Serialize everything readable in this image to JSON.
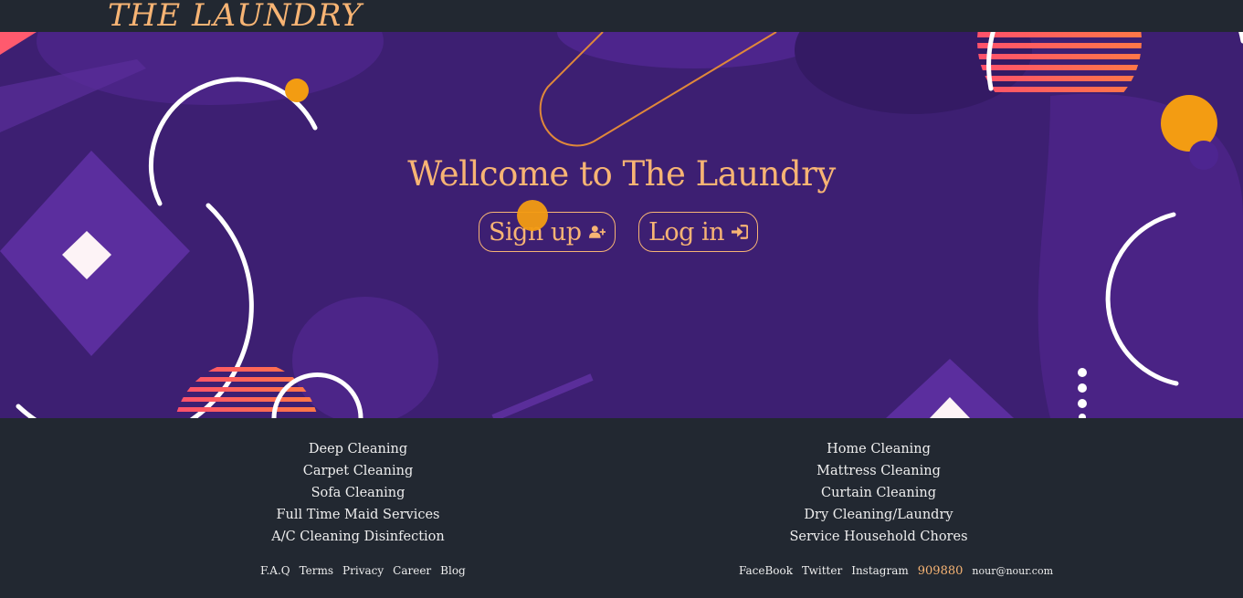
{
  "header": {
    "logo": "THE LAUNDRY"
  },
  "hero": {
    "title": "Wellcome to The Laundry",
    "signup_label": "Sign up",
    "login_label": "Log in"
  },
  "footer": {
    "services_left": [
      "Deep Cleaning",
      "Carpet Cleaning",
      "Sofa Cleaning",
      "Full Time Maid Services",
      "A/C Cleaning Disinfection"
    ],
    "services_right": [
      "Home Cleaning",
      "Mattress Cleaning",
      "Curtain Cleaning",
      "Dry Cleaning/Laundry",
      "Service Household Chores"
    ],
    "links_left": [
      "F.A.Q",
      "Terms",
      "Privacy",
      "Career",
      "Blog"
    ],
    "social": [
      "FaceBook",
      "Twitter",
      "Instagram"
    ],
    "phone": "909880",
    "email": "nour@nour.com"
  },
  "colors": {
    "accent": "#f7b474",
    "background": "#222831",
    "hero": "#3b1f70",
    "orange": "#f39c12"
  }
}
